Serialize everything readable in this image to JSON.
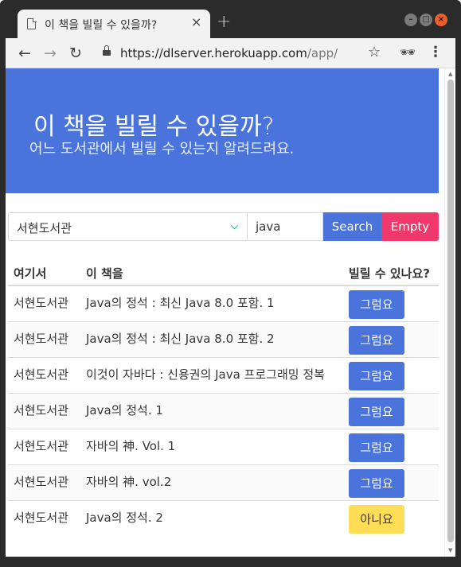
{
  "browser": {
    "tab_title": "이 책을 빌릴 수 있을까?",
    "tab_close": "×",
    "new_tab": "+",
    "url_host": "https://dlserver.herokuapp.com",
    "url_path": "/app/",
    "icons": [
      "document-icon",
      "back-icon",
      "forward-icon",
      "reload-icon",
      "lock-icon",
      "star-icon",
      "incognito-icon",
      "menu-icon"
    ]
  },
  "hero": {
    "title": "이 책을 빌릴 수 있을까?",
    "subtitle": "어느 도서관에서 빌릴 수 있는지 알려드려요."
  },
  "search": {
    "library_selected": "서현도서관",
    "query_value": "java",
    "search_label": "Search",
    "empty_label": "Empty"
  },
  "table": {
    "headers": [
      "여기서",
      "이 책을",
      "빌릴 수 있나요?"
    ],
    "rows": [
      {
        "library": "서현도서관",
        "title": "Java의 정석 : 최신 Java 8.0 포함. 1",
        "available": "그럼요"
      },
      {
        "library": "서현도서관",
        "title": "Java의 정석 : 최신 Java 8.0 포함. 2",
        "available": "그럼요"
      },
      {
        "library": "서현도서관",
        "title": "이것이 자바다 : 신용권의 Java 프로그래밍 정복",
        "available": "그럼요"
      },
      {
        "library": "서현도서관",
        "title": "Java의 정석. 1",
        "available": "그럼요"
      },
      {
        "library": "서현도서관",
        "title": "자바의 神. Vol. 1",
        "available": "그럼요"
      },
      {
        "library": "서현도서관",
        "title": "자바의 神. vol.2",
        "available": "그럼요"
      },
      {
        "library": "서현도서관",
        "title": "Java의 정석. 2",
        "available": "아니요"
      }
    ]
  },
  "colors": {
    "primary": "#4a74db",
    "danger": "#f0386b",
    "warning": "#ffdd57",
    "teal": "#00d1b2"
  }
}
